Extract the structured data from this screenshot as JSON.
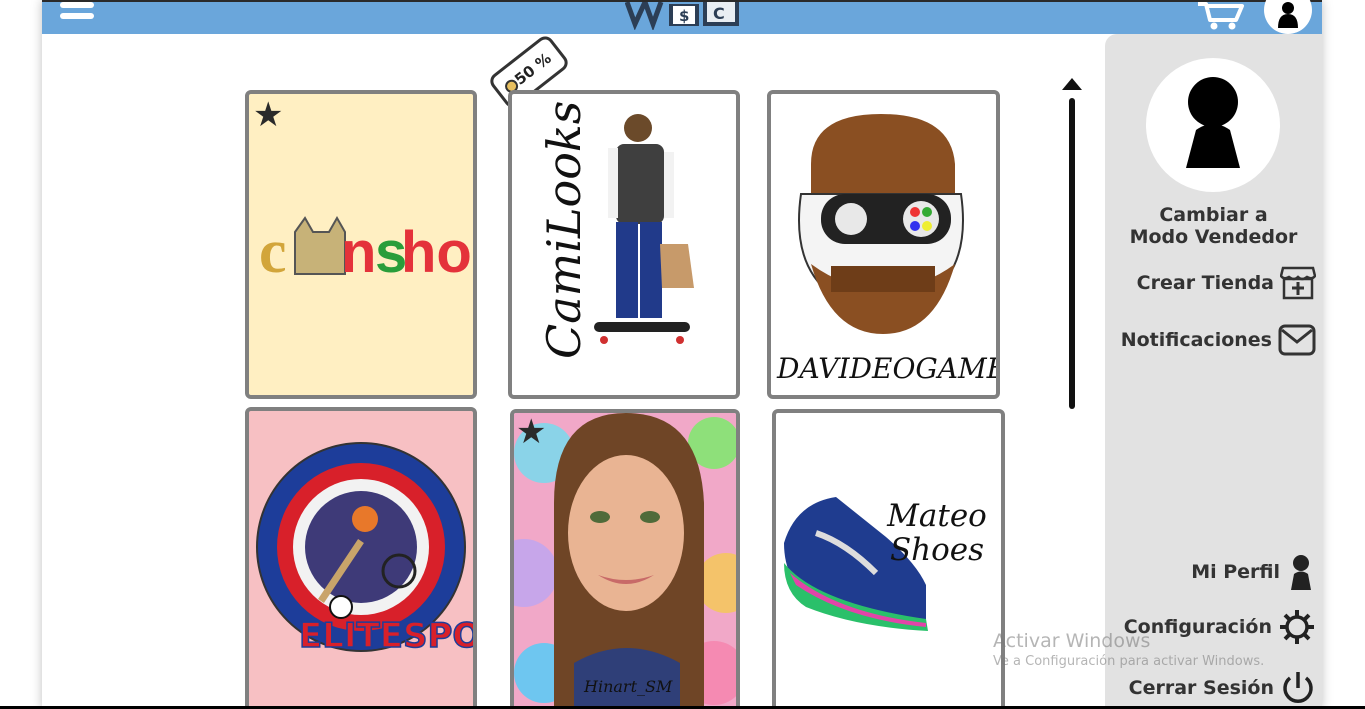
{
  "header": {
    "menu_icon": "hamburger-menu-icon",
    "logo_icon": "store-logo",
    "cart_icon": "shopping-cart-icon",
    "user_icon": "user-avatar-icon",
    "bar_color": "#6aa6db"
  },
  "discount_tag": "50 %",
  "stores": [
    {
      "name": "Canishop",
      "featured": true,
      "bg": "#ffefc2"
    },
    {
      "name": "CamiLooks",
      "featured": false,
      "bg": "#ffffff"
    },
    {
      "name": "DAVIDEOGAMES",
      "featured": false,
      "bg": "#ffffff"
    },
    {
      "name": "ELITESPORT",
      "featured": false,
      "bg": "#f7c0c3"
    },
    {
      "name": "Hinart_SM",
      "featured": true,
      "bg": "#ffffff"
    },
    {
      "name": "Mateo Shoes",
      "featured": false,
      "bg": "#ffffff"
    }
  ],
  "side_panel": {
    "title_line1": "Cambiar a",
    "title_line2": "Modo Vendedor",
    "create_store": "Crear Tienda",
    "notifications": "Notificaciones",
    "my_profile": "Mi Perfil",
    "settings": "Configuración",
    "logout": "Cerrar Sesión"
  },
  "watermark": {
    "line1": "Activar Windows",
    "line2": "Ve a Configuración para activar Windows."
  }
}
